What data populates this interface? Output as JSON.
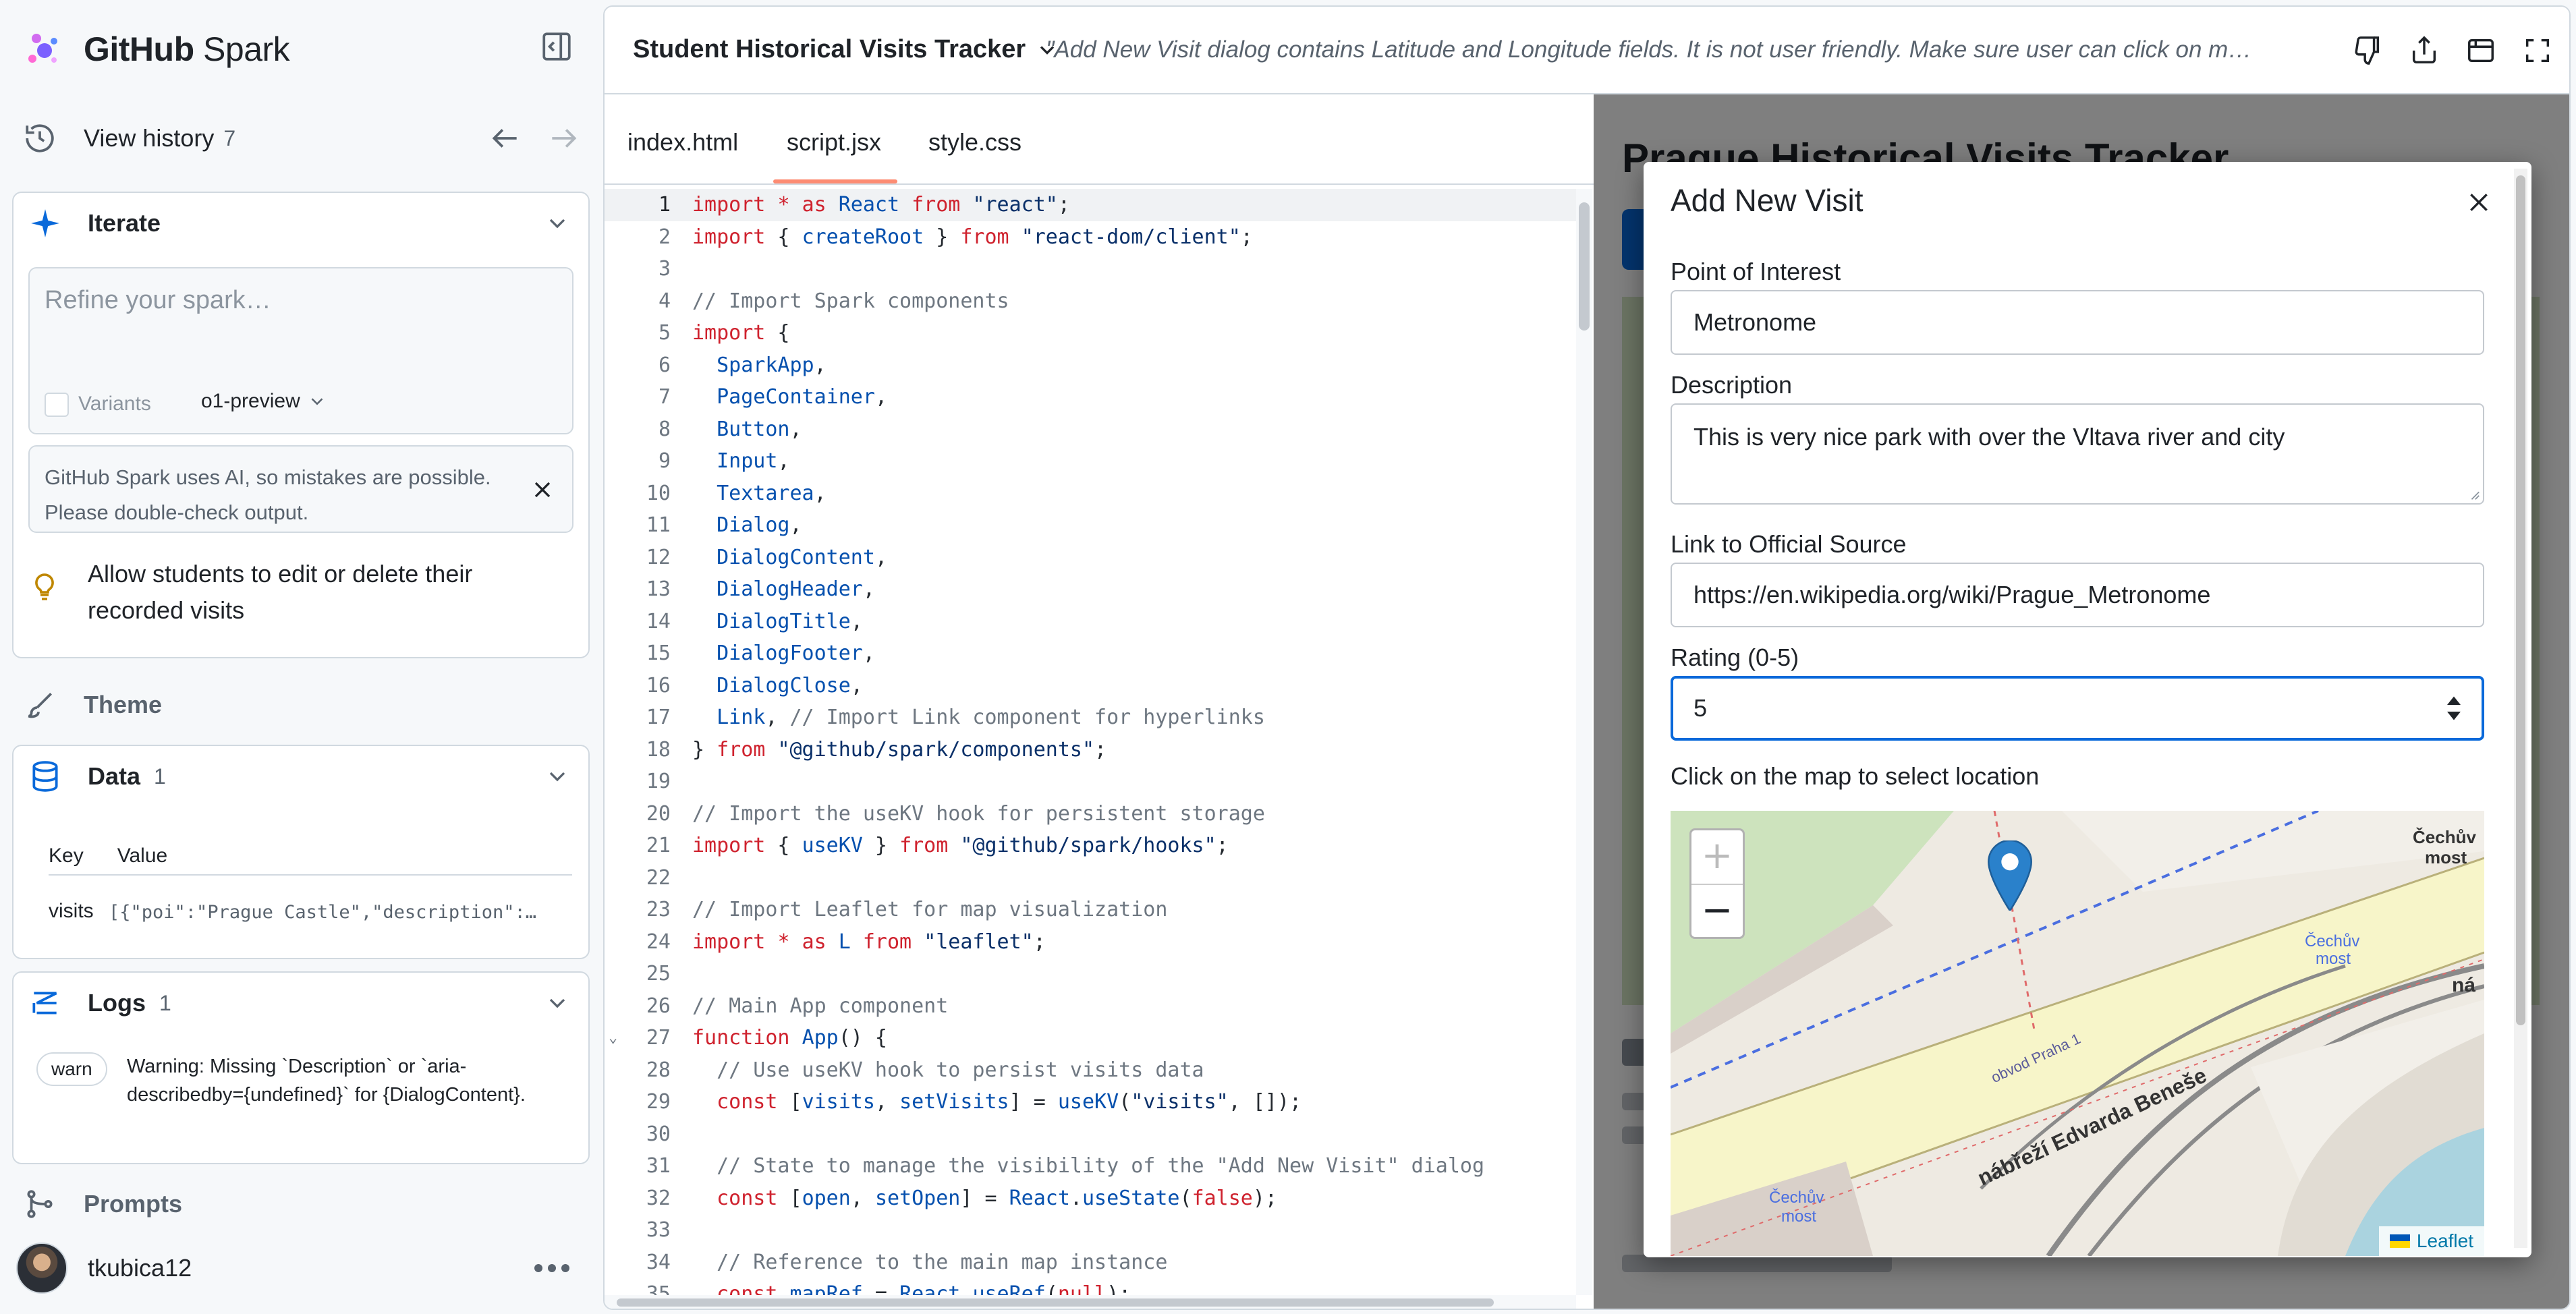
{
  "brand": {
    "name_bold": "GitHub",
    "name_light": "Spark"
  },
  "sidebar": {
    "history": {
      "label": "View history",
      "count": "7"
    },
    "iterate": {
      "title": "Iterate",
      "placeholder": "Refine your spark…",
      "variants_label": "Variants",
      "model": "o1-preview",
      "notice": "GitHub Spark uses AI, so mistakes are possible. Please double-check output.",
      "suggestion": "Allow students to edit or delete their recorded visits"
    },
    "theme": {
      "label": "Theme"
    },
    "data": {
      "title": "Data",
      "count": "1",
      "col_key": "Key",
      "col_value": "Value",
      "rows": [
        {
          "key": "visits",
          "value": "[{\"poi\":\"Prague Castle\",\"description\":\"One of the largest castles in the world\"}]"
        }
      ]
    },
    "logs": {
      "title": "Logs",
      "count": "1",
      "entries": [
        {
          "level": "warn",
          "message": "Warning: Missing `Description` or `aria-describedby={undefined}` for {DialogContent}."
        }
      ]
    },
    "prompts": {
      "label": "Prompts"
    },
    "user": {
      "name": "tkubica12"
    }
  },
  "topbar": {
    "project_title": "Student Historical Visits Tracker",
    "last_prompt": "\"Add New Visit dialog contains Latitude and Longitude fields. It is not user friendly. Make sure user can click on map and select location\""
  },
  "editor": {
    "tabs": [
      "index.html",
      "script.jsx",
      "style.css"
    ],
    "active_tab": "script.jsx",
    "current_line": 1,
    "lines": [
      [
        [
          "kw",
          "import"
        ],
        [
          "t",
          " "
        ],
        [
          "kw",
          "*"
        ],
        [
          "t",
          " "
        ],
        [
          "kw",
          "as"
        ],
        [
          "t",
          " "
        ],
        [
          "id",
          "React"
        ],
        [
          "t",
          " "
        ],
        [
          "kw",
          "from"
        ],
        [
          "t",
          " "
        ],
        [
          "str",
          "\"react\""
        ],
        [
          "t",
          ";"
        ]
      ],
      [
        [
          "kw",
          "import"
        ],
        [
          "t",
          " { "
        ],
        [
          "id",
          "createRoot"
        ],
        [
          "t",
          " } "
        ],
        [
          "kw",
          "from"
        ],
        [
          "t",
          " "
        ],
        [
          "str",
          "\"react-dom/client\""
        ],
        [
          "t",
          ";"
        ]
      ],
      [],
      [
        [
          "cm",
          "// Import Spark components"
        ]
      ],
      [
        [
          "kw",
          "import"
        ],
        [
          "t",
          " {"
        ]
      ],
      [
        [
          "t",
          "  "
        ],
        [
          "id",
          "SparkApp"
        ],
        [
          "t",
          ","
        ]
      ],
      [
        [
          "t",
          "  "
        ],
        [
          "id",
          "PageContainer"
        ],
        [
          "t",
          ","
        ]
      ],
      [
        [
          "t",
          "  "
        ],
        [
          "id",
          "Button"
        ],
        [
          "t",
          ","
        ]
      ],
      [
        [
          "t",
          "  "
        ],
        [
          "id",
          "Input"
        ],
        [
          "t",
          ","
        ]
      ],
      [
        [
          "t",
          "  "
        ],
        [
          "id",
          "Textarea"
        ],
        [
          "t",
          ","
        ]
      ],
      [
        [
          "t",
          "  "
        ],
        [
          "id",
          "Dialog"
        ],
        [
          "t",
          ","
        ]
      ],
      [
        [
          "t",
          "  "
        ],
        [
          "id",
          "DialogContent"
        ],
        [
          "t",
          ","
        ]
      ],
      [
        [
          "t",
          "  "
        ],
        [
          "id",
          "DialogHeader"
        ],
        [
          "t",
          ","
        ]
      ],
      [
        [
          "t",
          "  "
        ],
        [
          "id",
          "DialogTitle"
        ],
        [
          "t",
          ","
        ]
      ],
      [
        [
          "t",
          "  "
        ],
        [
          "id",
          "DialogFooter"
        ],
        [
          "t",
          ","
        ]
      ],
      [
        [
          "t",
          "  "
        ],
        [
          "id",
          "DialogClose"
        ],
        [
          "t",
          ","
        ]
      ],
      [
        [
          "t",
          "  "
        ],
        [
          "id",
          "Link"
        ],
        [
          "t",
          ", "
        ],
        [
          "cm",
          "// Import Link component for hyperlinks"
        ]
      ],
      [
        [
          "t",
          "} "
        ],
        [
          "kw",
          "from"
        ],
        [
          "t",
          " "
        ],
        [
          "str",
          "\"@github/spark/components\""
        ],
        [
          "t",
          ";"
        ]
      ],
      [],
      [
        [
          "cm",
          "// Import the useKV hook for persistent storage"
        ]
      ],
      [
        [
          "kw",
          "import"
        ],
        [
          "t",
          " { "
        ],
        [
          "id",
          "useKV"
        ],
        [
          "t",
          " } "
        ],
        [
          "kw",
          "from"
        ],
        [
          "t",
          " "
        ],
        [
          "str",
          "\"@github/spark/hooks\""
        ],
        [
          "t",
          ";"
        ]
      ],
      [],
      [
        [
          "cm",
          "// Import Leaflet for map visualization"
        ]
      ],
      [
        [
          "kw",
          "import"
        ],
        [
          "t",
          " "
        ],
        [
          "kw",
          "*"
        ],
        [
          "t",
          " "
        ],
        [
          "kw",
          "as"
        ],
        [
          "t",
          " "
        ],
        [
          "id",
          "L"
        ],
        [
          "t",
          " "
        ],
        [
          "kw",
          "from"
        ],
        [
          "t",
          " "
        ],
        [
          "str",
          "\"leaflet\""
        ],
        [
          "t",
          ";"
        ]
      ],
      [],
      [
        [
          "cm",
          "// Main App component"
        ]
      ],
      [
        [
          "kw",
          "function"
        ],
        [
          "t",
          " "
        ],
        [
          "id",
          "App"
        ],
        [
          "t",
          "() {"
        ]
      ],
      [
        [
          "t",
          "  "
        ],
        [
          "cm",
          "// Use useKV hook to persist visits data"
        ]
      ],
      [
        [
          "t",
          "  "
        ],
        [
          "kw",
          "const"
        ],
        [
          "t",
          " ["
        ],
        [
          "id",
          "visits"
        ],
        [
          "t",
          ", "
        ],
        [
          "id",
          "setVisits"
        ],
        [
          "t",
          "] = "
        ],
        [
          "id",
          "useKV"
        ],
        [
          "t",
          "("
        ],
        [
          "str",
          "\"visits\""
        ],
        [
          "t",
          ", []);"
        ]
      ],
      [],
      [
        [
          "t",
          "  "
        ],
        [
          "cm",
          "// State to manage the visibility of the \"Add New Visit\" dialog"
        ]
      ],
      [
        [
          "t",
          "  "
        ],
        [
          "kw",
          "const"
        ],
        [
          "t",
          " ["
        ],
        [
          "id",
          "open"
        ],
        [
          "t",
          ", "
        ],
        [
          "id",
          "setOpen"
        ],
        [
          "t",
          "] = "
        ],
        [
          "id",
          "React"
        ],
        [
          "t",
          "."
        ],
        [
          "id",
          "useState"
        ],
        [
          "t",
          "("
        ],
        [
          "bool",
          "false"
        ],
        [
          "t",
          ");"
        ]
      ],
      [],
      [
        [
          "t",
          "  "
        ],
        [
          "cm",
          "// Reference to the main map instance"
        ]
      ],
      [
        [
          "t",
          "  "
        ],
        [
          "kw",
          "const"
        ],
        [
          "t",
          " "
        ],
        [
          "id",
          "mapRef"
        ],
        [
          "t",
          " = "
        ],
        [
          "id",
          "React"
        ],
        [
          "t",
          "."
        ],
        [
          "id",
          "useRef"
        ],
        [
          "t",
          "("
        ],
        [
          "kw",
          "null"
        ],
        [
          "t",
          ");"
        ]
      ]
    ]
  },
  "preview": {
    "background_title": "Prague Historical Visits Tracker",
    "dialog": {
      "title": "Add New Visit",
      "poi_label": "Point of Interest",
      "poi_value": "Metronome",
      "description_label": "Description",
      "description_value": "This is very nice park with over the Vltava river and city",
      "link_label": "Link to Official Source",
      "link_value": "https://en.wikipedia.org/wiki/Prague_Metronome",
      "rating_label": "Rating (0-5)",
      "rating_value": "5",
      "map_hint": "Click on the map to select location",
      "map": {
        "zoom_in": "+",
        "zoom_out": "−",
        "attribution": "Leaflet",
        "labels": {
          "cechuv_most_1": "Čechův",
          "cechuv_most_1b": "most",
          "cechuv_most_2": "Čechův",
          "cechuv_most_2b": "most",
          "cechuv_most_3": "Čechův",
          "cechuv_most_3b": "most",
          "nabrezi": "nábřeží Edvarda Beneše",
          "obvod": "obvod Praha 1",
          "na": "ná"
        }
      }
    }
  },
  "colors": {
    "accent": "#0969da",
    "tab_underline": "#fd8c73",
    "keyword": "#cf222e",
    "string": "#0a3069",
    "comment": "#6e7781",
    "identifier": "#0550ae"
  },
  "icons": {
    "brand": "spark-logo-icon",
    "collapse": "sidebar-collapse-icon",
    "history": "history-icon",
    "iterate": "sparkle-icon",
    "theme": "paintbrush-icon",
    "data": "database-icon",
    "logs": "logs-icon",
    "prompts": "git-branch-icon",
    "suggestion": "lightbulb-icon",
    "thumbs_down": "thumbs-down-icon",
    "share": "share-icon",
    "preview": "browser-icon",
    "fullscreen": "fullscreen-icon",
    "map_marker": "map-marker-icon"
  }
}
